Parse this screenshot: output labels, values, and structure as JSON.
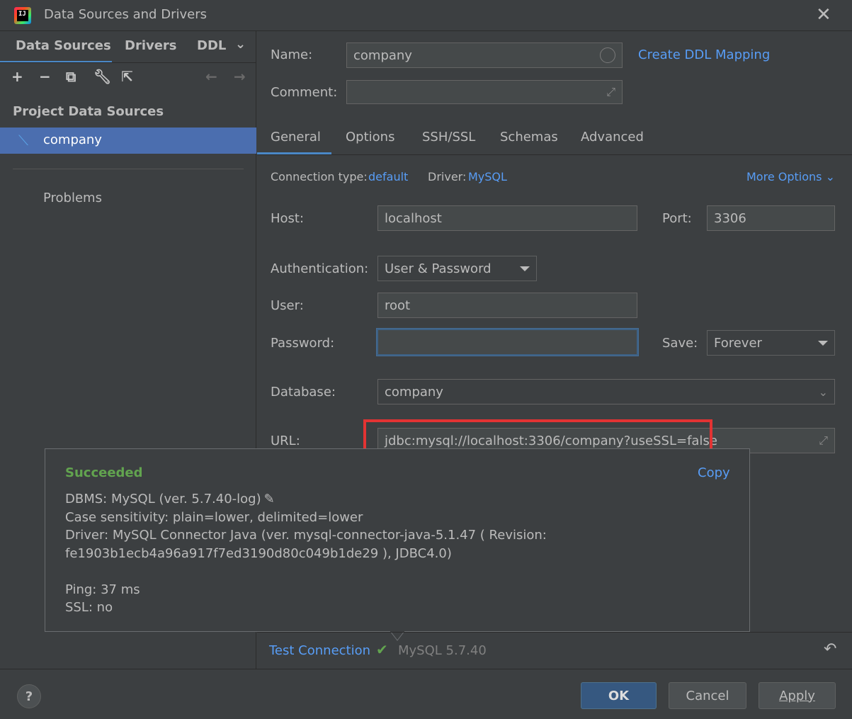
{
  "window": {
    "title": "Data Sources and Drivers",
    "logo_text": "IJ"
  },
  "left": {
    "tabs": [
      "Data Sources",
      "Drivers",
      "DDL"
    ],
    "section_title": "Project Data Sources",
    "items": [
      {
        "label": "company"
      }
    ],
    "problems_label": "Problems"
  },
  "form": {
    "name_label": "Name:",
    "name_value": "company",
    "create_ddl_link": "Create DDL Mapping",
    "comment_label": "Comment:",
    "comment_value": "",
    "tabs": [
      "General",
      "Options",
      "SSH/SSL",
      "Schemas",
      "Advanced"
    ],
    "conn_type_label": "Connection type:",
    "conn_type_value": "default",
    "driver_label": "Driver:",
    "driver_value": "MySQL",
    "more_options": "More Options",
    "host_label": "Host:",
    "host_value": "localhost",
    "port_label": "Port:",
    "port_value": "3306",
    "auth_label": "Authentication:",
    "auth_value": "User & Password",
    "user_label": "User:",
    "user_value": "root",
    "password_label": "Password:",
    "password_value": "",
    "save_label": "Save:",
    "save_value": "Forever",
    "database_label": "Database:",
    "database_value": "company",
    "url_label": "URL:",
    "url_value": "jdbc:mysql://localhost:3306/company?useSSL=false"
  },
  "popup": {
    "status": "Succeeded",
    "copy_label": "Copy",
    "lines": [
      "DBMS: MySQL (ver. 5.7.40-log)",
      "Case sensitivity: plain=lower, delimited=lower",
      "Driver: MySQL Connector Java (ver. mysql-connector-java-5.1.47 ( Revision:",
      "fe1903b1ecb4a96a917f7ed3190d80c049b1de29 ), JDBC4.0)",
      "Ping: 37 ms",
      "SSL: no"
    ]
  },
  "test": {
    "link": "Test Connection",
    "result": "MySQL 5.7.40"
  },
  "footer": {
    "help": "?",
    "ok": "OK",
    "cancel": "Cancel",
    "apply": "Apply"
  },
  "colors": {
    "accent": "#589df6",
    "success": "#62a44f",
    "highlight_box": "#e33333",
    "selection": "#4b6eaf"
  }
}
